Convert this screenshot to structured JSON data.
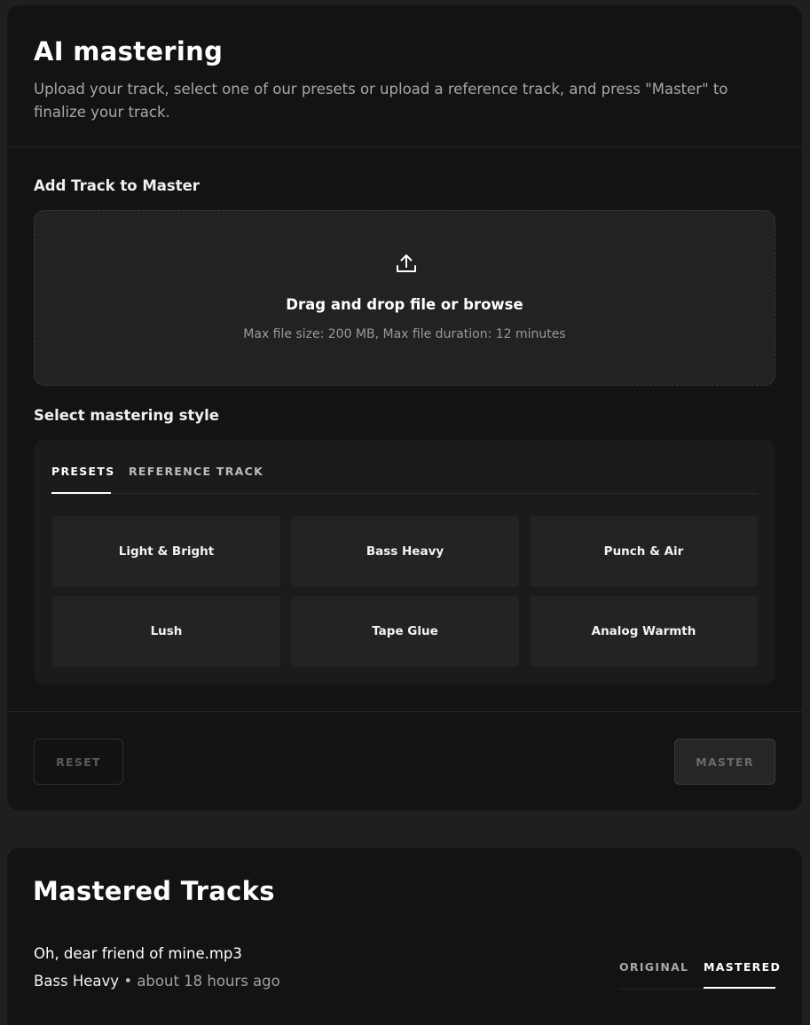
{
  "header": {
    "title": "AI mastering",
    "subtitle": "Upload your track, select one of our presets or upload a reference track, and press \"Master\" to finalize your track."
  },
  "upload": {
    "section_label": "Add Track to Master",
    "icon": "upload-icon",
    "title": "Drag and drop file or browse",
    "note": "Max file size: 200 MB, Max file duration: 12 minutes"
  },
  "style": {
    "section_label": "Select mastering style",
    "tabs": [
      {
        "label": "PRESETS",
        "active": true
      },
      {
        "label": "REFERENCE TRACK",
        "active": false
      }
    ],
    "presets": [
      "Light & Bright",
      "Bass Heavy",
      "Punch & Air",
      "Lush",
      "Tape Glue",
      "Analog Warmth"
    ]
  },
  "actions": {
    "reset_label": "RESET",
    "master_label": "MASTER"
  },
  "mastered": {
    "title": "Mastered Tracks",
    "tracks": [
      {
        "name": "Oh, dear friend of mine.mp3",
        "preset": "Bass Heavy",
        "separator": "•",
        "time": "about 18 hours ago",
        "tabs": [
          {
            "label": "ORIGINAL",
            "active": false
          },
          {
            "label": "MASTERED",
            "active": true
          }
        ]
      }
    ]
  },
  "colors": {
    "page_background": "#1f1f1f",
    "panel_background": "#131313",
    "card_background": "#222222",
    "preset_background": "#232323",
    "text_primary": "#ffffff",
    "text_muted": "#a7a7a7"
  }
}
